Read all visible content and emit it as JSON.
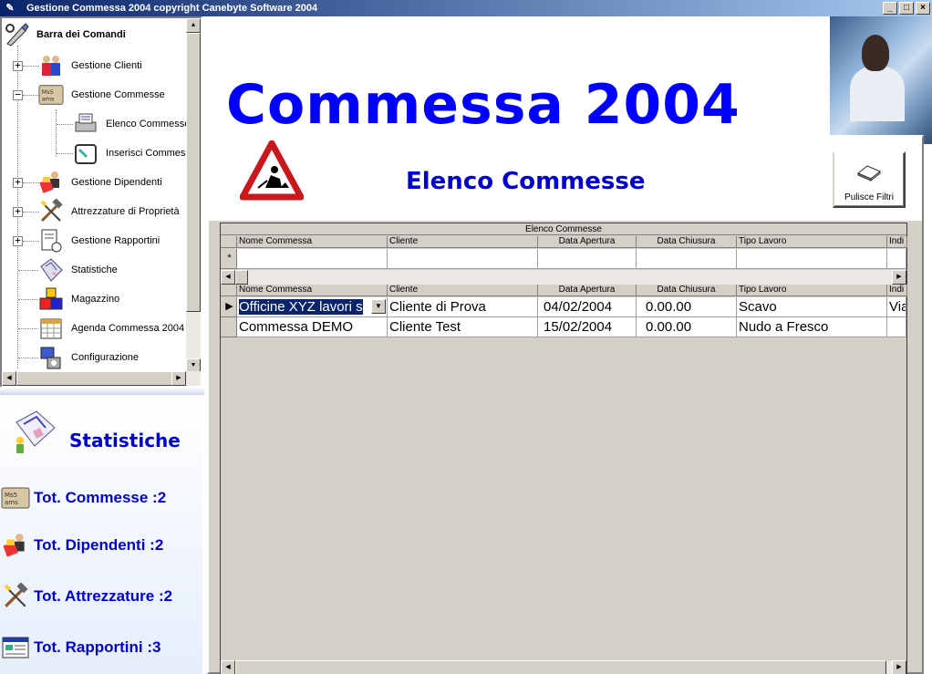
{
  "window": {
    "title": "Gestione Commessa 2004    copyright Canebyte Software 2004",
    "buttons": {
      "minimize": "_",
      "maximize": "□",
      "close": "×"
    }
  },
  "tree": {
    "root": {
      "label": "Barra dei Comandi",
      "icon": "wrench-pencil-icon"
    },
    "items": [
      {
        "label": "Gestione Clienti",
        "icon": "people-icon",
        "expander": "+"
      },
      {
        "label": "Gestione Commesse",
        "icon": "commesse-book-icon",
        "expander": "−"
      },
      {
        "label": "Elenco Commesse",
        "icon": "printer-list-icon"
      },
      {
        "label": "Inserisci Commesse",
        "icon": "pen-tablet-icon"
      },
      {
        "label": "Gestione Dipendenti",
        "icon": "worker-icon",
        "expander": "+"
      },
      {
        "label": "Attrezzature di Proprietà",
        "icon": "hammer-icon",
        "expander": "+"
      },
      {
        "label": "Gestione Rapportini",
        "icon": "report-icon",
        "expander": "+"
      },
      {
        "label": "Statistiche",
        "icon": "stats-icon"
      },
      {
        "label": "Magazzino",
        "icon": "boxes-icon"
      },
      {
        "label": "Agenda Commessa 2004",
        "icon": "calendar-icon"
      },
      {
        "label": "Configurazione",
        "icon": "config-icon"
      }
    ]
  },
  "stats": {
    "title": "Statistiche",
    "rows": [
      {
        "label": "Tot. Commesse :2",
        "icon": "commesse-book-icon"
      },
      {
        "label": "Tot. Dipendenti :2",
        "icon": "worker-icon"
      },
      {
        "label": "Tot. Attrezzature :2",
        "icon": "hammer-icon"
      },
      {
        "label": "Tot. Rapportini :3",
        "icon": "report-window-icon"
      }
    ]
  },
  "main": {
    "big_title": "Commessa 2004",
    "sub_title": "Elenco Commesse",
    "filter_button": "Pulisce Filtri"
  },
  "grid": {
    "caption": "Elenco Commesse",
    "columns": [
      "Nome Commessa",
      "Cliente",
      "Data Apertura",
      "Data Chiusura",
      "Tipo Lavoro",
      "Indi"
    ],
    "new_row_marker": "*",
    "current_row_marker": "▶",
    "rows": [
      [
        "Officine XYZ lavori s",
        "Cliente di Prova",
        "04/02/2004",
        "0.00.00",
        "Scavo",
        "Via"
      ],
      [
        "Commessa DEMO",
        "Cliente Test",
        "15/02/2004",
        "0.00.00",
        "Nudo a Fresco",
        ""
      ]
    ]
  }
}
